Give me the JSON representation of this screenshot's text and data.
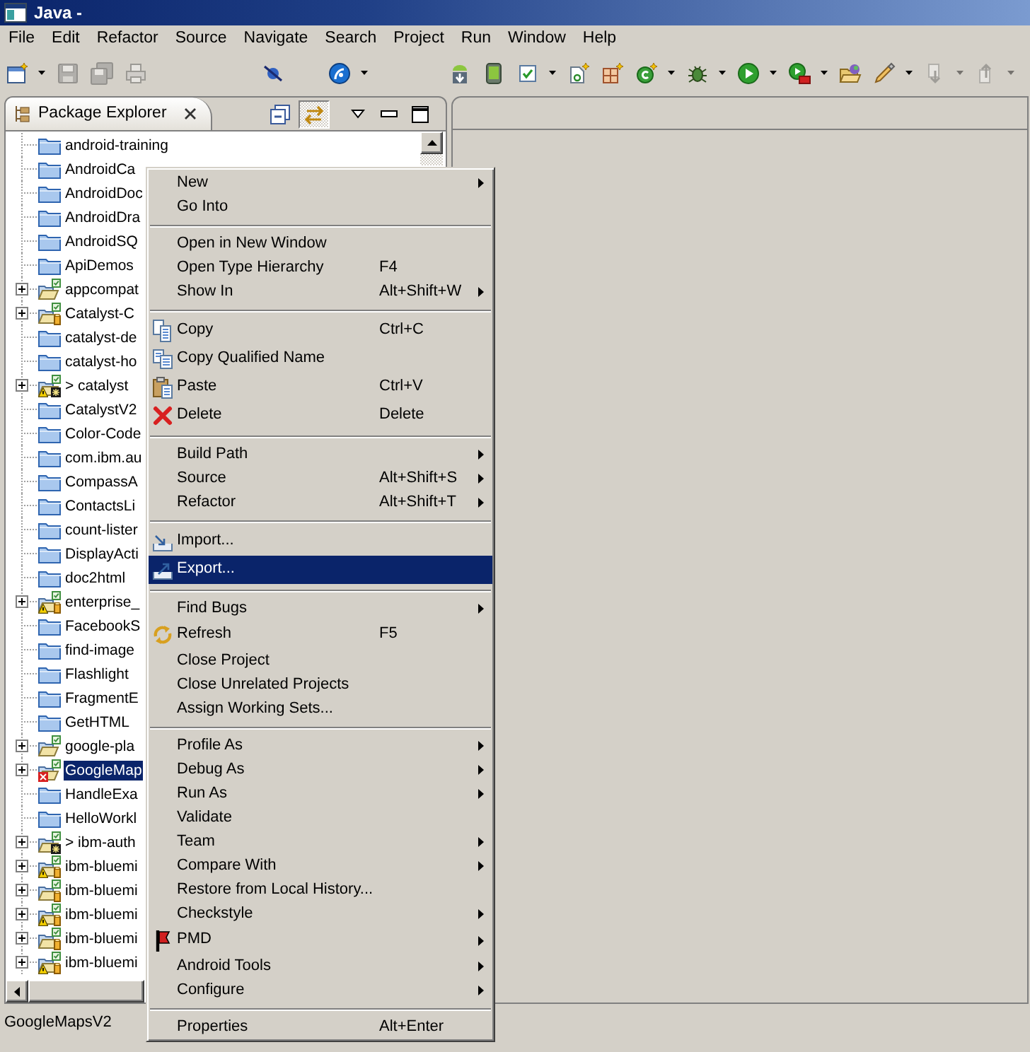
{
  "window": {
    "title": "Java -"
  },
  "menu_bar": [
    "File",
    "Edit",
    "Refactor",
    "Source",
    "Navigate",
    "Search",
    "Project",
    "Run",
    "Window",
    "Help"
  ],
  "toolbar": [
    {
      "disabled": false,
      "dropdown": true
    },
    {
      "disabled": true,
      "dropdown": false
    },
    {
      "disabled": true,
      "dropdown": false
    },
    {
      "disabled": true,
      "dropdown": false
    },
    {
      "disabled": false,
      "dropdown": false
    },
    {
      "disabled": false,
      "dropdown": true
    },
    {
      "disabled": false,
      "dropdown": false
    },
    {
      "disabled": false,
      "dropdown": false
    },
    {
      "disabled": false,
      "dropdown": true
    },
    {
      "disabled": false,
      "dropdown": false
    },
    {
      "disabled": false,
      "dropdown": false
    },
    {
      "disabled": false,
      "dropdown": true
    },
    {
      "disabled": false,
      "dropdown": true
    },
    {
      "disabled": false,
      "dropdown": true
    },
    {
      "disabled": false,
      "dropdown": true
    },
    {
      "disabled": false,
      "dropdown": false
    },
    {
      "disabled": false,
      "dropdown": true
    },
    {
      "disabled": true,
      "dropdown": true
    },
    {
      "disabled": true,
      "dropdown": true
    }
  ],
  "package_explorer": {
    "tab": {
      "title": "Package Explorer",
      "selected": true
    },
    "view_buttons": [
      {
        "pressed": false
      },
      {
        "pressed": true
      }
    ],
    "tree": [
      {
        "label": "android-training",
        "kind": "closed",
        "warning": false,
        "error": false,
        "selected": false
      },
      {
        "label": "AndroidCa",
        "kind": "closed",
        "warning": false,
        "error": false,
        "selected": false
      },
      {
        "label": "AndroidDoc",
        "kind": "closed",
        "warning": false,
        "error": false,
        "selected": false
      },
      {
        "label": "AndroidDra",
        "kind": "closed",
        "warning": false,
        "error": false,
        "selected": false
      },
      {
        "label": "AndroidSQ",
        "kind": "closed",
        "warning": false,
        "error": false,
        "selected": false
      },
      {
        "label": "ApiDemos",
        "kind": "closed",
        "warning": false,
        "error": false,
        "selected": false
      },
      {
        "label": "appcompat",
        "kind": "open",
        "warning": false,
        "error": false,
        "selected": false
      },
      {
        "label": "Catalyst-C",
        "kind": "open-jar",
        "warning": false,
        "error": false,
        "selected": false
      },
      {
        "label": "catalyst-de",
        "kind": "closed",
        "warning": false,
        "error": false,
        "selected": false
      },
      {
        "label": "catalyst-ho",
        "kind": "closed",
        "warning": false,
        "error": false,
        "selected": false
      },
      {
        "label": "> catalyst",
        "kind": "open-repo",
        "warning": true,
        "error": false,
        "selected": false
      },
      {
        "label": "CatalystV2",
        "kind": "closed",
        "warning": false,
        "error": false,
        "selected": false
      },
      {
        "label": "Color-Code",
        "kind": "closed",
        "warning": false,
        "error": false,
        "selected": false
      },
      {
        "label": "com.ibm.au",
        "kind": "closed",
        "warning": false,
        "error": false,
        "selected": false
      },
      {
        "label": "CompassA",
        "kind": "closed",
        "warning": false,
        "error": false,
        "selected": false
      },
      {
        "label": "ContactsLi",
        "kind": "closed",
        "warning": false,
        "error": false,
        "selected": false
      },
      {
        "label": "count-lister",
        "kind": "closed",
        "warning": false,
        "error": false,
        "selected": false
      },
      {
        "label": "DisplayActi",
        "kind": "closed",
        "warning": false,
        "error": false,
        "selected": false
      },
      {
        "label": "doc2html",
        "kind": "closed",
        "warning": false,
        "error": false,
        "selected": false
      },
      {
        "label": "enterprise_",
        "kind": "open-jar",
        "warning": true,
        "error": false,
        "selected": false
      },
      {
        "label": "FacebookS",
        "kind": "closed",
        "warning": false,
        "error": false,
        "selected": false
      },
      {
        "label": "find-image",
        "kind": "closed",
        "warning": false,
        "error": false,
        "selected": false
      },
      {
        "label": "Flashlight",
        "kind": "closed",
        "warning": false,
        "error": false,
        "selected": false
      },
      {
        "label": "FragmentE",
        "kind": "closed",
        "warning": false,
        "error": false,
        "selected": false
      },
      {
        "label": "GetHTML",
        "kind": "closed",
        "warning": false,
        "error": false,
        "selected": false
      },
      {
        "label": "google-pla",
        "kind": "open",
        "warning": false,
        "error": false,
        "selected": false
      },
      {
        "label": "GoogleMap",
        "kind": "open",
        "warning": false,
        "error": true,
        "selected": true
      },
      {
        "label": "HandleExa",
        "kind": "closed",
        "warning": false,
        "error": false,
        "selected": false
      },
      {
        "label": "HelloWorkl",
        "kind": "closed",
        "warning": false,
        "error": false,
        "selected": false
      },
      {
        "label": "> ibm-auth",
        "kind": "open-repo",
        "warning": false,
        "error": false,
        "selected": false
      },
      {
        "label": "ibm-bluemi",
        "kind": "open-jar",
        "warning": true,
        "error": false,
        "selected": false
      },
      {
        "label": "ibm-bluemi",
        "kind": "open-jar",
        "warning": false,
        "error": false,
        "selected": false
      },
      {
        "label": "ibm-bluemi",
        "kind": "open-jar",
        "warning": true,
        "error": false,
        "selected": false
      },
      {
        "label": "ibm-bluemi",
        "kind": "open-jar",
        "warning": false,
        "error": false,
        "selected": false
      },
      {
        "label": "ibm-bluemi",
        "kind": "open-jar",
        "warning": true,
        "error": false,
        "selected": false
      }
    ]
  },
  "context_menu": {
    "items": [
      {
        "kind": "item",
        "label": "New",
        "submenu": true,
        "selected": false
      },
      {
        "kind": "item",
        "label": "Go Into",
        "submenu": false,
        "selected": false
      },
      {
        "kind": "separator"
      },
      {
        "kind": "item",
        "label": "Open in New Window",
        "submenu": false,
        "selected": false
      },
      {
        "kind": "item",
        "label": "Open Type Hierarchy",
        "shortcut": "F4",
        "submenu": false,
        "selected": false
      },
      {
        "kind": "item",
        "label": "Show In",
        "shortcut": "Alt+Shift+W",
        "submenu": true,
        "selected": false
      },
      {
        "kind": "separator"
      },
      {
        "kind": "item",
        "label": "Copy",
        "shortcut": "Ctrl+C",
        "submenu": false,
        "selected": false
      },
      {
        "kind": "item",
        "label": "Copy Qualified Name",
        "submenu": false,
        "selected": false
      },
      {
        "kind": "item",
        "label": "Paste",
        "shortcut": "Ctrl+V",
        "submenu": false,
        "selected": false
      },
      {
        "kind": "item",
        "label": "Delete",
        "shortcut": "Delete",
        "submenu": false,
        "selected": false
      },
      {
        "kind": "separator"
      },
      {
        "kind": "item",
        "label": "Build Path",
        "submenu": true,
        "selected": false
      },
      {
        "kind": "item",
        "label": "Source",
        "shortcut": "Alt+Shift+S",
        "submenu": true,
        "selected": false
      },
      {
        "kind": "item",
        "label": "Refactor",
        "shortcut": "Alt+Shift+T",
        "submenu": true,
        "selected": false
      },
      {
        "kind": "separator"
      },
      {
        "kind": "item",
        "label": "Import...",
        "submenu": false,
        "selected": false
      },
      {
        "kind": "item",
        "label": "Export...",
        "submenu": false,
        "selected": true
      },
      {
        "kind": "separator"
      },
      {
        "kind": "item",
        "label": "Find Bugs",
        "submenu": true,
        "selected": false
      },
      {
        "kind": "item",
        "label": "Refresh",
        "shortcut": "F5",
        "submenu": false,
        "selected": false
      },
      {
        "kind": "item",
        "label": "Close Project",
        "submenu": false,
        "selected": false
      },
      {
        "kind": "item",
        "label": "Close Unrelated Projects",
        "submenu": false,
        "selected": false
      },
      {
        "kind": "item",
        "label": "Assign Working Sets...",
        "submenu": false,
        "selected": false
      },
      {
        "kind": "separator"
      },
      {
        "kind": "item",
        "label": "Profile As",
        "submenu": true,
        "selected": false
      },
      {
        "kind": "item",
        "label": "Debug As",
        "submenu": true,
        "selected": false
      },
      {
        "kind": "item",
        "label": "Run As",
        "submenu": true,
        "selected": false
      },
      {
        "kind": "item",
        "label": "Validate",
        "submenu": false,
        "selected": false
      },
      {
        "kind": "item",
        "label": "Team",
        "submenu": true,
        "selected": false
      },
      {
        "kind": "item",
        "label": "Compare With",
        "submenu": true,
        "selected": false
      },
      {
        "kind": "item",
        "label": "Restore from Local History...",
        "submenu": false,
        "selected": false
      },
      {
        "kind": "item",
        "label": "Checkstyle",
        "submenu": true,
        "selected": false
      },
      {
        "kind": "item",
        "label": "PMD",
        "submenu": true,
        "selected": false
      },
      {
        "kind": "item",
        "label": "Android Tools",
        "submenu": true,
        "selected": false
      },
      {
        "kind": "item",
        "label": "Configure",
        "submenu": true,
        "selected": false
      },
      {
        "kind": "separator"
      },
      {
        "kind": "item",
        "label": "Properties",
        "shortcut": "Alt+Enter",
        "submenu": false,
        "selected": false
      }
    ]
  },
  "status_bar": {
    "text": "GoogleMapsV2"
  }
}
